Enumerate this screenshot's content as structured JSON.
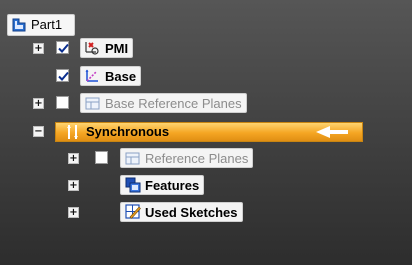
{
  "tree": {
    "root": {
      "label": "Part1"
    },
    "pmi": {
      "label": "PMI",
      "checked": true
    },
    "base": {
      "label": "Base",
      "checked": true
    },
    "base_ref_planes": {
      "label": "Base Reference Planes",
      "checked": false
    },
    "synchronous": {
      "label": "Synchronous"
    },
    "ref_planes": {
      "label": "Reference Planes",
      "checked": false
    },
    "features": {
      "label": "Features"
    },
    "used_sketches": {
      "label": "Used Sketches"
    }
  },
  "colors": {
    "background": "#4a4a4a",
    "highlight": "#f5a623",
    "dim_text": "#8c8c8c"
  },
  "icons": {
    "root": "part-icon",
    "pmi": "pmi-icon",
    "base": "coordinate-system-icon",
    "planes": "reference-planes-icon",
    "synchronous": "synchronous-icon",
    "features": "features-icon",
    "sketches": "sketches-icon"
  }
}
